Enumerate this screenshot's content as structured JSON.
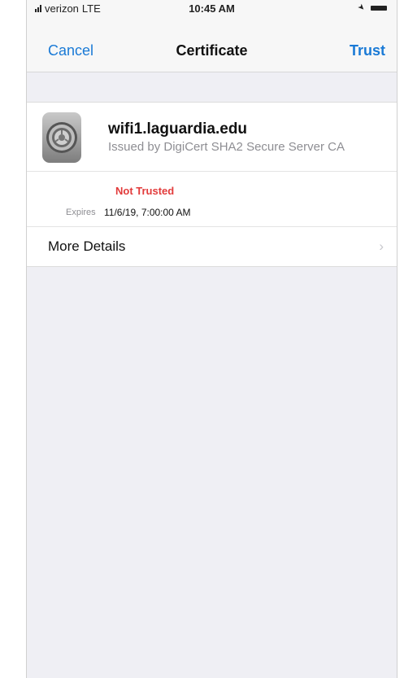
{
  "status_bar": {
    "carrier": "verizon",
    "network": "LTE",
    "time": "10:45 AM",
    "icons": [
      "signal-icon",
      "location-icon",
      "battery-icon"
    ]
  },
  "nav": {
    "cancel_label": "Cancel",
    "title": "Certificate",
    "trust_label": "Trust"
  },
  "certificate": {
    "icon": "settings-gear-icon",
    "name": "wifi1.laguardia.edu",
    "issuer": "Issued by DigiCert SHA2 Secure Server CA",
    "status": "Not Trusted",
    "expires_label": "Expires",
    "expires_value": "11/6/19, 7:00:00 AM"
  },
  "details": {
    "label": "More Details",
    "chevron": "›"
  },
  "colors": {
    "accent": "#1a7ad6",
    "danger": "#e23b3b",
    "secondary_text": "#8e8e93",
    "background": "#efeff4"
  }
}
